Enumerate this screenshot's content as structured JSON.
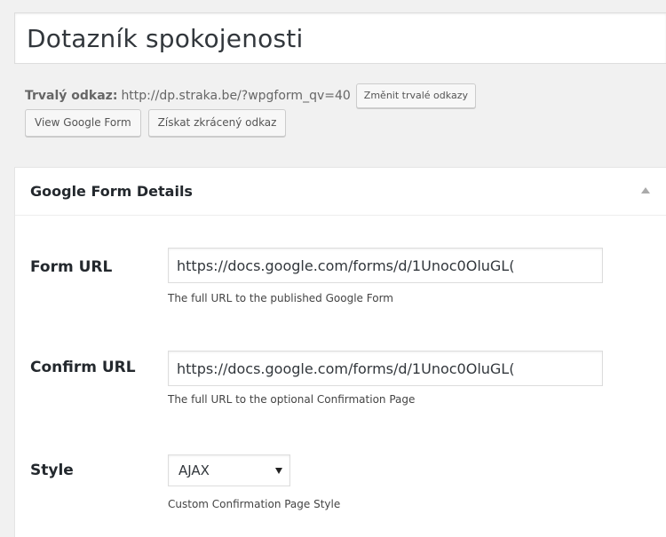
{
  "post": {
    "title": "Dotazník spokojenosti"
  },
  "permalink": {
    "label": "Trvalý odkaz:",
    "url": "http://dp.straka.be/?wpgform_qv=40",
    "change_button": "Změnit trvalé odkazy",
    "view_button": "View Google Form",
    "shortlink_button": "Získat zkrácený odkaz"
  },
  "metabox": {
    "title": "Google Form Details",
    "fields": {
      "form_url": {
        "label": "Form URL",
        "value": "https://docs.google.com/forms/d/1Unoc0OluGL(",
        "description": "The full URL to the published Google Form"
      },
      "confirm_url": {
        "label": "Confirm URL",
        "value": "https://docs.google.com/forms/d/1Unoc0OluGL(",
        "description": "The full URL to the optional Confirmation Page"
      },
      "style": {
        "label": "Style",
        "selected": "AJAX",
        "description": "Custom Confirmation Page Style"
      }
    }
  },
  "icons": {
    "toggle": "triangle-up-icon",
    "select_arrow": "chevron-down-icon"
  },
  "colors": {
    "background": "#f1f1f1",
    "panel": "#ffffff",
    "border": "#dddddd",
    "text": "#23282d"
  }
}
